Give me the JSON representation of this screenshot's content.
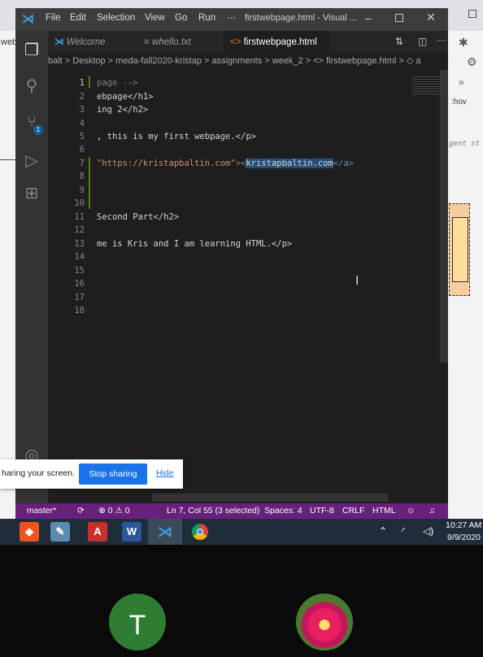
{
  "bg_browser": {
    "tab_left": "web",
    "devtools_hov": ":hov",
    "devtools_gentst": "gent st",
    "devtools_chevron": "»"
  },
  "titlebar": {
    "menu": [
      "File",
      "Edit",
      "Selection",
      "View",
      "Go",
      "Run",
      "···"
    ],
    "title": "firstwebpage.html - Visual ..."
  },
  "tabs": [
    {
      "label": "Welcome"
    },
    {
      "label": "whello.txt"
    },
    {
      "label": "firstwebpage.html"
    }
  ],
  "breadcrumb": "balt > Desktop > meda-fall2020-kristap > assignments > week_2 > <> firstwebpage.html > ◇ a",
  "editor": {
    "line_numbers": [
      "1",
      "2",
      "3",
      "4",
      "5",
      "6",
      "7",
      "8",
      "9",
      "10",
      "11",
      "12",
      "13",
      "14",
      "15",
      "16",
      "17",
      "18"
    ],
    "lines": {
      "l1": "page -->",
      "l2": "ebpage</h1>",
      "l3": "ing 2</h2>",
      "l5": ", this is my first webpage.</p>",
      "l7a": "\"https://kristapbaltin.com\"",
      "l7b": "kristapbaltin.com",
      "l11": "Second Part</h2>",
      "l13": "me is Kris and I am learning HTML.</p>"
    }
  },
  "activity_badge": "1",
  "share": {
    "text": "haring your screen.",
    "stop_label": "Stop sharing",
    "hide_label": "Hide"
  },
  "statusbar": {
    "branch": "master*",
    "problems": "⊗ 0 ⚠ 0",
    "position": "Ln 7, Col 55 (3 selected)",
    "spaces": "Spaces: 4",
    "encoding": "UTF-8",
    "eol": "CRLF",
    "language": "HTML"
  },
  "taskbar": {
    "time": "10:27 AM",
    "date": "9/9/2020"
  },
  "participants": {
    "t_initial": "T"
  }
}
